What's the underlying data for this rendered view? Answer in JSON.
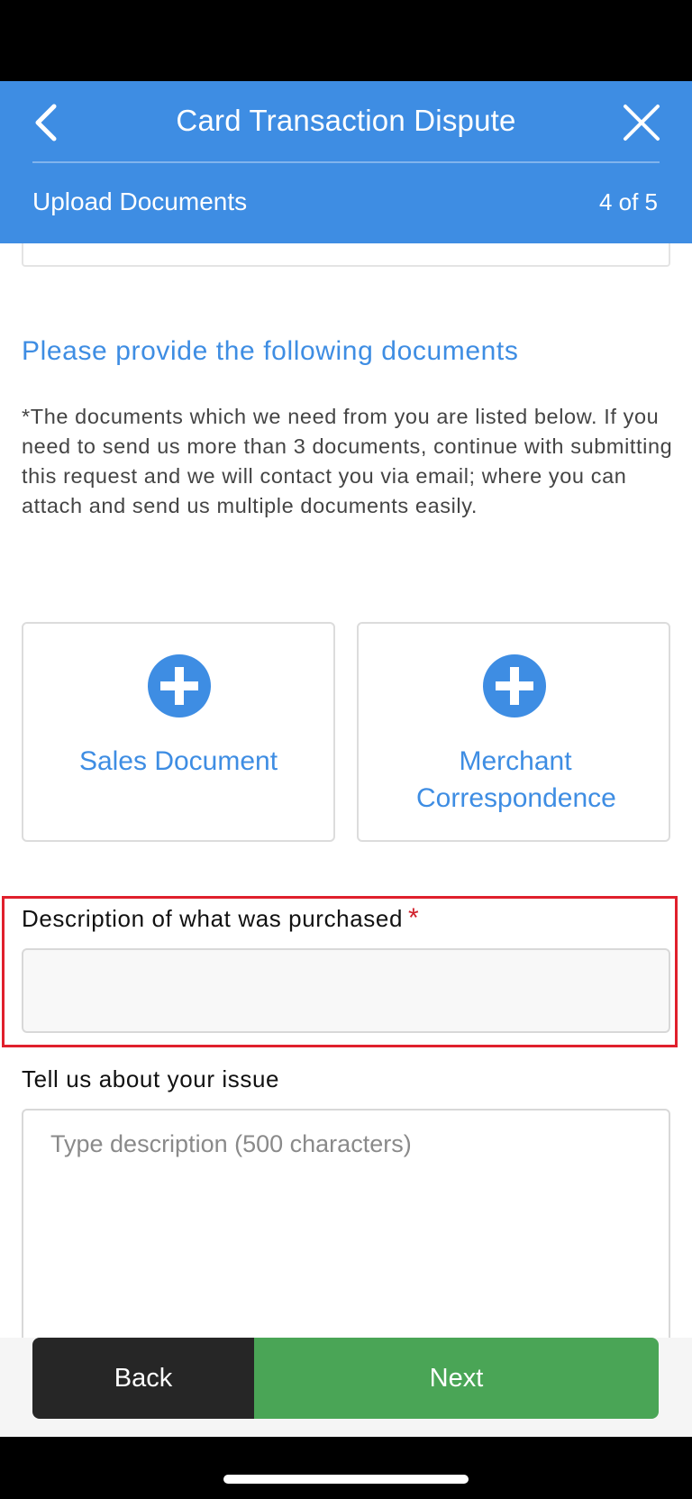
{
  "header": {
    "title": "Card Transaction Dispute",
    "step_label": "Upload Documents",
    "step_count": "4 of 5"
  },
  "section": {
    "heading": "Please provide the following documents",
    "notice": "*The documents which we need from you are listed below. If you need to send us more than 3 documents, continue with submitting this request and we will contact you via email; where you can attach and send us multiple documents easily."
  },
  "documents": [
    {
      "label": "Sales Document"
    },
    {
      "label": "Merchant Correspondence"
    }
  ],
  "form": {
    "description_label": "Description of what was purchased",
    "required_marker": "*",
    "description_value": "",
    "issue_label": "Tell us about your issue",
    "issue_placeholder": "Type description (500 characters)"
  },
  "footer": {
    "back_label": "Back",
    "next_label": "Next"
  },
  "colors": {
    "header_blue": "#3e8de3",
    "next_green": "#4aa556",
    "back_dark": "#262626",
    "required_red": "#d0202c",
    "highlight_red": "#e0202c"
  },
  "icons": {
    "back": "chevron-left-icon",
    "close": "close-icon",
    "add": "plus-circle-icon"
  }
}
